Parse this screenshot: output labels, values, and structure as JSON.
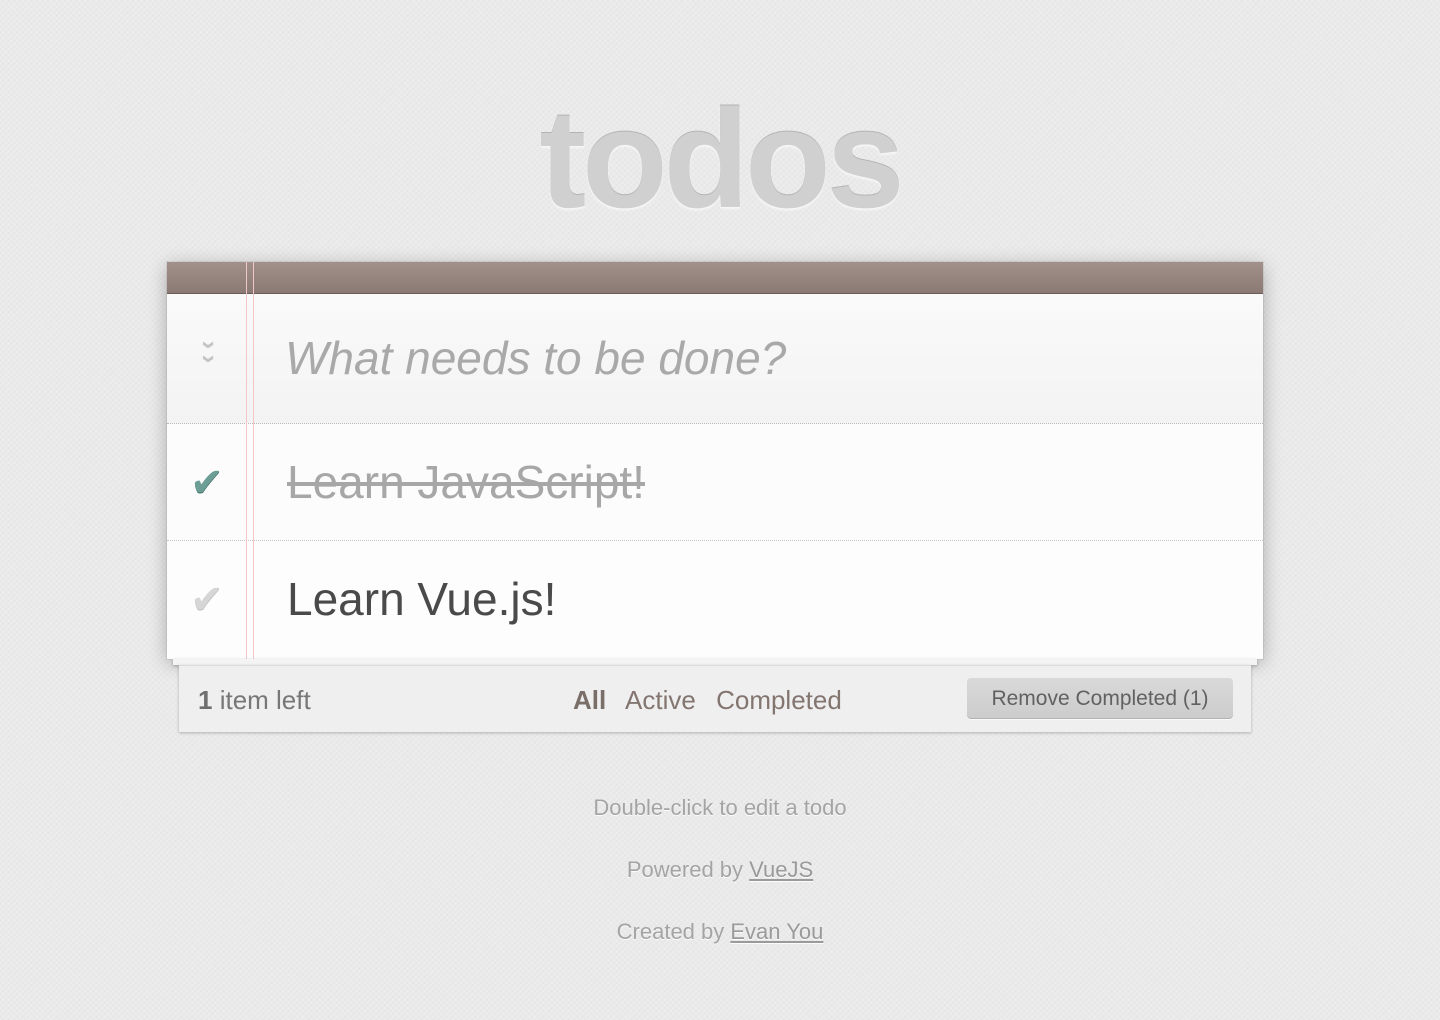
{
  "header": {
    "title": "todos"
  },
  "new_todo": {
    "placeholder": "What needs to be done?",
    "toggle_all_icon": "double-chevron-down-icon"
  },
  "todos": [
    {
      "title": "Learn JavaScript!",
      "completed": true
    },
    {
      "title": "Learn Vue.js!",
      "completed": false
    }
  ],
  "footer": {
    "count_number": "1",
    "count_suffix": " item left",
    "filters": [
      {
        "label": "All",
        "selected": true
      },
      {
        "label": "Active",
        "selected": false
      },
      {
        "label": "Completed",
        "selected": false
      }
    ],
    "clear_label": "Remove Completed (1)"
  },
  "info": {
    "hint": "Double-click to edit a todo",
    "powered_prefix": "Powered by ",
    "powered_link": "VueJS",
    "created_prefix": "Created by ",
    "created_link": "Evan You"
  },
  "colors": {
    "accent_topbar": "#8b7a73",
    "check_done": "#6c9e96",
    "check_open": "#d6d6d6",
    "margin_line": "#f2c7c7"
  }
}
